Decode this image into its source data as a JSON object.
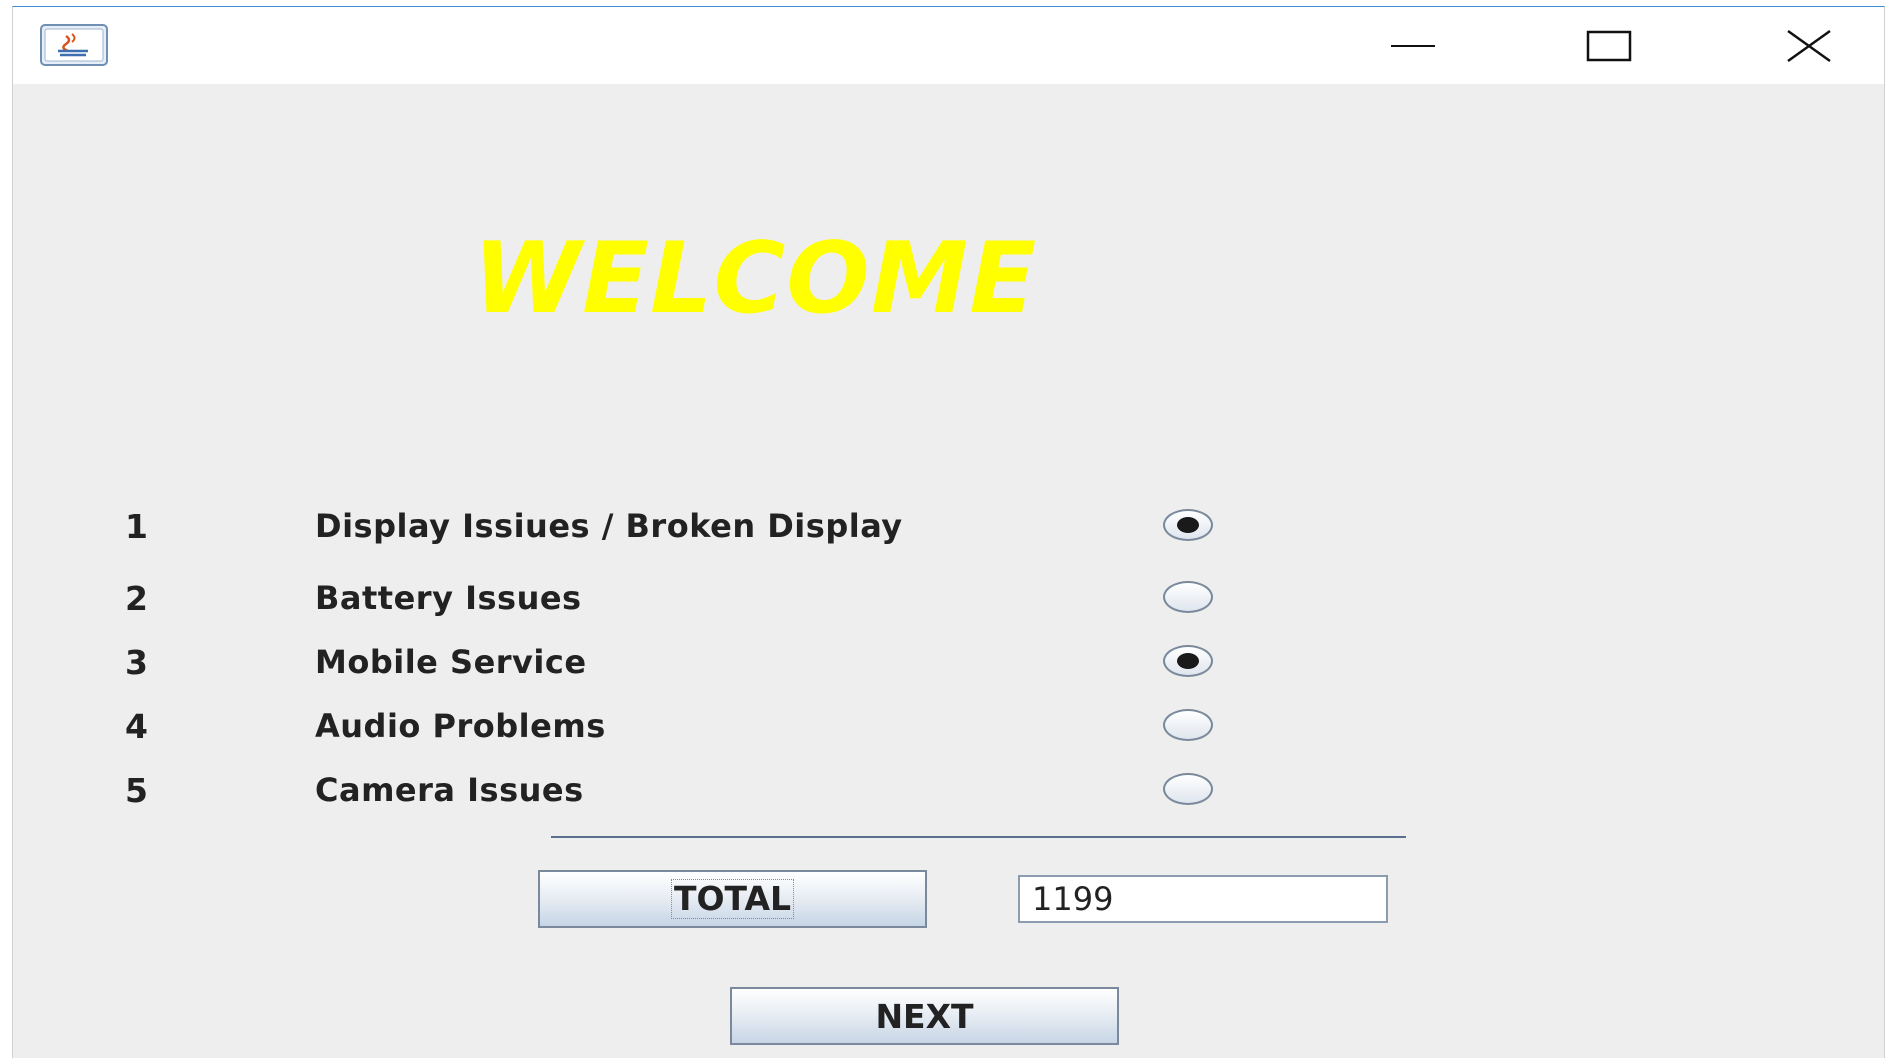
{
  "titlebar": {
    "icon": "java-app-icon",
    "minimize_icon": "minimize-icon",
    "maximize_icon": "maximize-icon",
    "close_icon": "close-icon"
  },
  "heading": "WELCOME",
  "heading_color": "#ffff00",
  "items": [
    {
      "number": "1",
      "label": "Display Issiues / Broken Display",
      "selected": true
    },
    {
      "number": "2",
      "label": "Battery Issues",
      "selected": false
    },
    {
      "number": "3",
      "label": "Mobile Service",
      "selected": true
    },
    {
      "number": "4",
      "label": "Audio Problems",
      "selected": false
    },
    {
      "number": "5",
      "label": "Camera Issues",
      "selected": false
    }
  ],
  "total_button_label": "TOTAL",
  "total_value": "1199",
  "next_button_label": "NEXT"
}
